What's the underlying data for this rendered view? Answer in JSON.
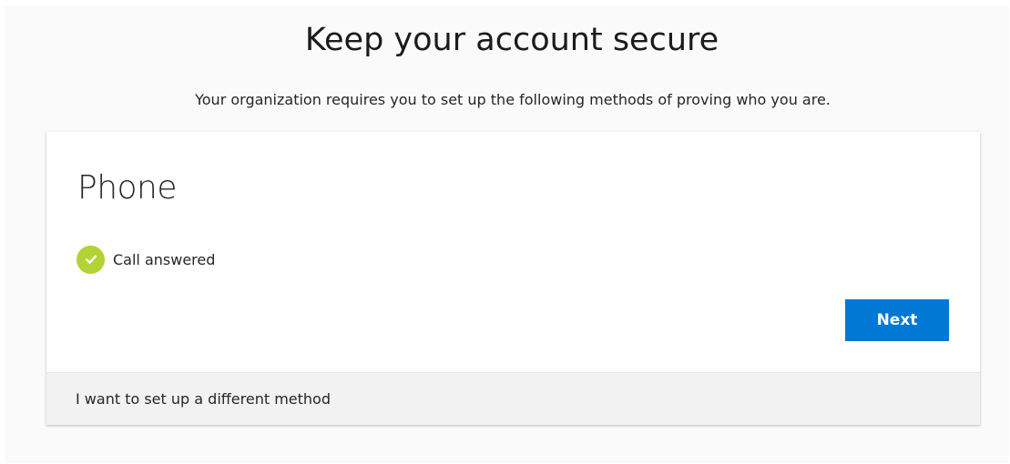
{
  "header": {
    "title": "Keep your account secure",
    "subtitle": "Your organization requires you to set up the following methods of proving who you are."
  },
  "card": {
    "title": "Phone",
    "status": {
      "icon": "check-circle-icon",
      "text": "Call answered",
      "color": "#b1d336"
    },
    "next_label": "Next",
    "next_color": "#0078d4",
    "footer_link": "I want to set up a different method"
  }
}
